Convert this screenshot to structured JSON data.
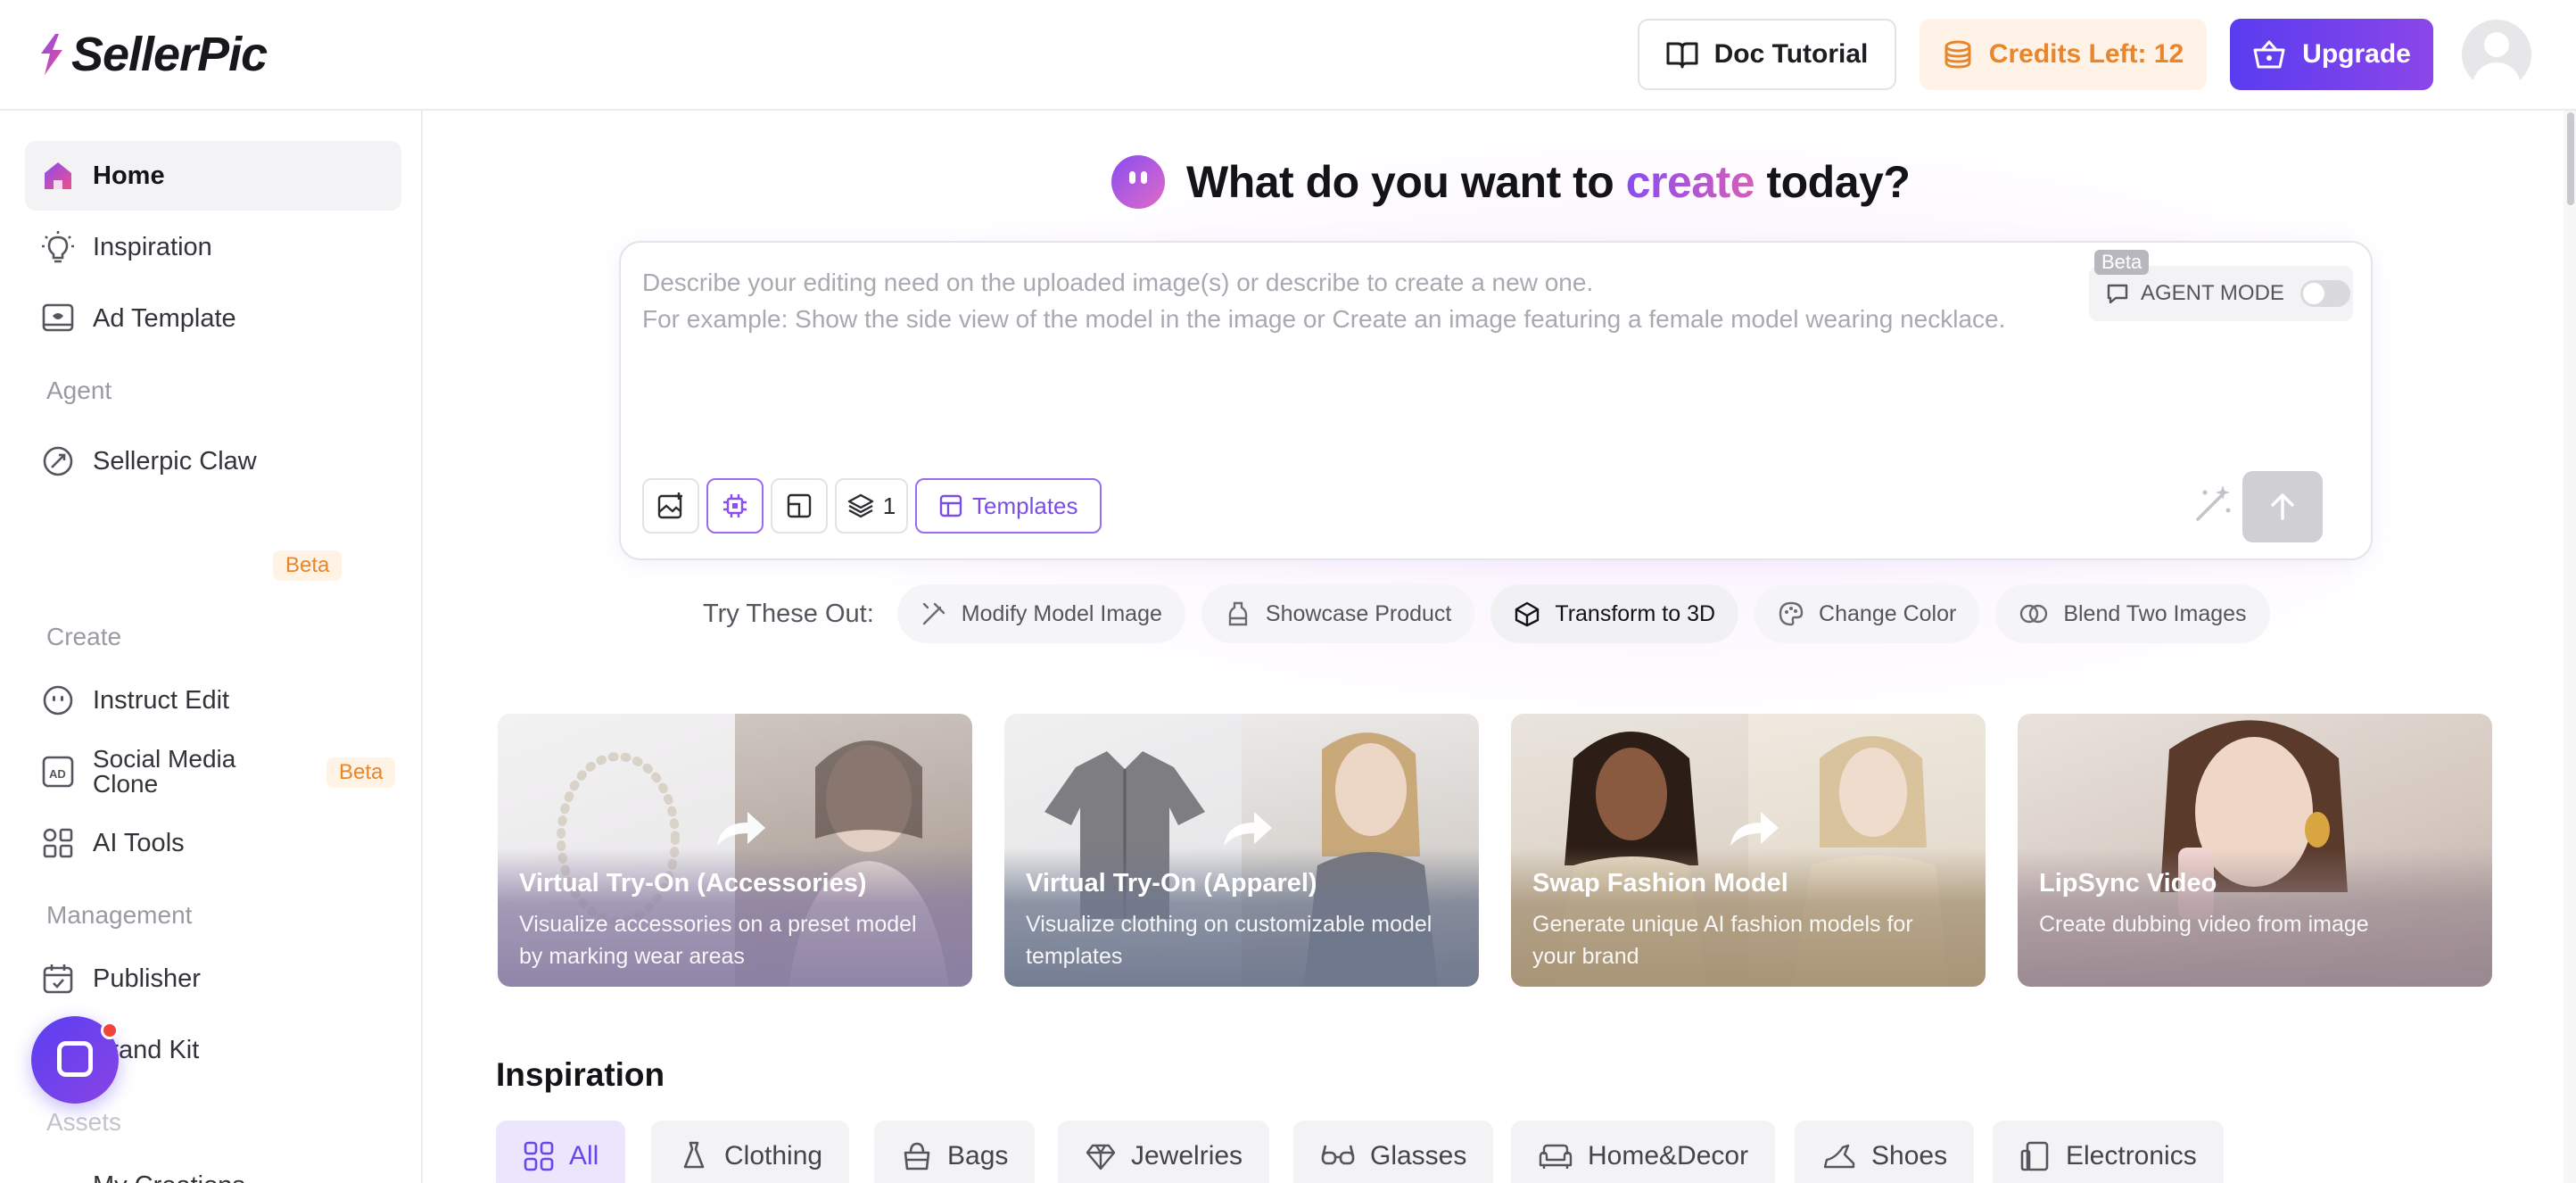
{
  "app": {
    "logo_text": "SellerPic"
  },
  "header": {
    "doc_tutorial": "Doc Tutorial",
    "credits": "Credits Left: 12",
    "upgrade": "Upgrade"
  },
  "sidebar": {
    "home": "Home",
    "inspiration": "Inspiration",
    "ad_template": "Ad Template",
    "section_agent": "Agent",
    "sellerpic_claw": "Sellerpic Claw",
    "claw_badge": "Beta",
    "section_create": "Create",
    "instruct_edit": "Instruct Edit",
    "social_media_clone": "Social Media Clone",
    "social_badge": "Beta",
    "ai_tools": "AI Tools",
    "section_management": "Management",
    "publisher": "Publisher",
    "brand_kit": "Brand Kit",
    "section_assets": "Assets",
    "my_creations": "My Creations"
  },
  "hero": {
    "prefix": "What do you want to",
    "accent": "create",
    "suffix": "today?"
  },
  "prompt": {
    "line1": "Describe your editing need on the uploaded image(s) or describe to create a new one.",
    "line2": "For example: Show the side view of the model in the image or Create an image featuring a female model wearing necklace.",
    "beta": "Beta",
    "agent_mode": "AGENT MODE",
    "count": "1",
    "templates": "Templates"
  },
  "try": {
    "label": "Try These Out:",
    "chips": [
      "Modify Model Image",
      "Showcase Product",
      "Transform to 3D",
      "Change Color",
      "Blend Two Images"
    ]
  },
  "features": [
    {
      "title": "Virtual Try-On (Accessories)",
      "desc": "Visualize accessories on a preset model by marking wear areas"
    },
    {
      "title": "Virtual Try-On (Apparel)",
      "desc": "Visualize clothing on customizable model templates"
    },
    {
      "title": "Swap Fashion Model",
      "desc": "Generate unique AI fashion models for your brand"
    },
    {
      "title": "LipSync Video",
      "desc": "Create dubbing video from image"
    }
  ],
  "inspiration": {
    "title": "Inspiration",
    "categories": [
      "All",
      "Clothing",
      "Bags",
      "Jewelries",
      "Glasses",
      "Home&Decor",
      "Shoes",
      "Electronics"
    ]
  },
  "colors": {
    "accent": "#7c4de6",
    "credits": "#e9852a",
    "upgrade_start": "#5a3cf0",
    "upgrade_end": "#8b46e8"
  }
}
